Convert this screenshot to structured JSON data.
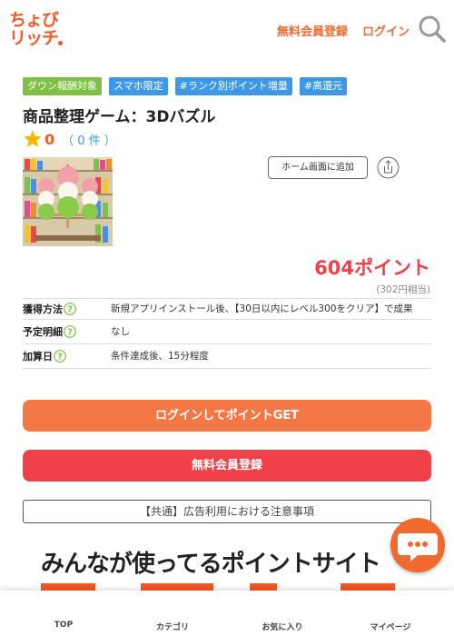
{
  "header": {
    "logo_line1": "ちょび",
    "logo_line2": "リッチ",
    "register_label": "無料会員登録",
    "login_label": "ログイン"
  },
  "tags": [
    "ダウン報酬対象",
    "スマホ限定",
    "#ランク別ポイント増量",
    "#高還元"
  ],
  "title": "商品整理ゲーム：3Dバズル",
  "rating": {
    "value": "0",
    "count": "（ 0 件 ）"
  },
  "home_button_label": "ホーム画面に追加",
  "points": {
    "main": "604ポイント",
    "sub": "(302円相当)"
  },
  "info": [
    {
      "label": "獲得方法",
      "value": "新規アプリインストール後、【30日以内にレベル300をクリア】で成果"
    },
    {
      "label": "予定明細",
      "value": "なし"
    },
    {
      "label": "加算日",
      "value": "条件達成後、15分程度"
    }
  ],
  "login_button_label": "ログインしてポイントGET",
  "register_button_label": "無料会員登録",
  "notice_label": "【共通】広告利用における注意事項",
  "banner_text": "みんなが使ってるポイントサイト",
  "nav": [
    "TOP",
    "カテゴリ",
    "お気に入り",
    "マイページ"
  ],
  "colors": {
    "accent": "#f05a28",
    "point_red": "#f0404a",
    "tag_blue": "#3d99e6",
    "tag_green": "#7dc043"
  }
}
